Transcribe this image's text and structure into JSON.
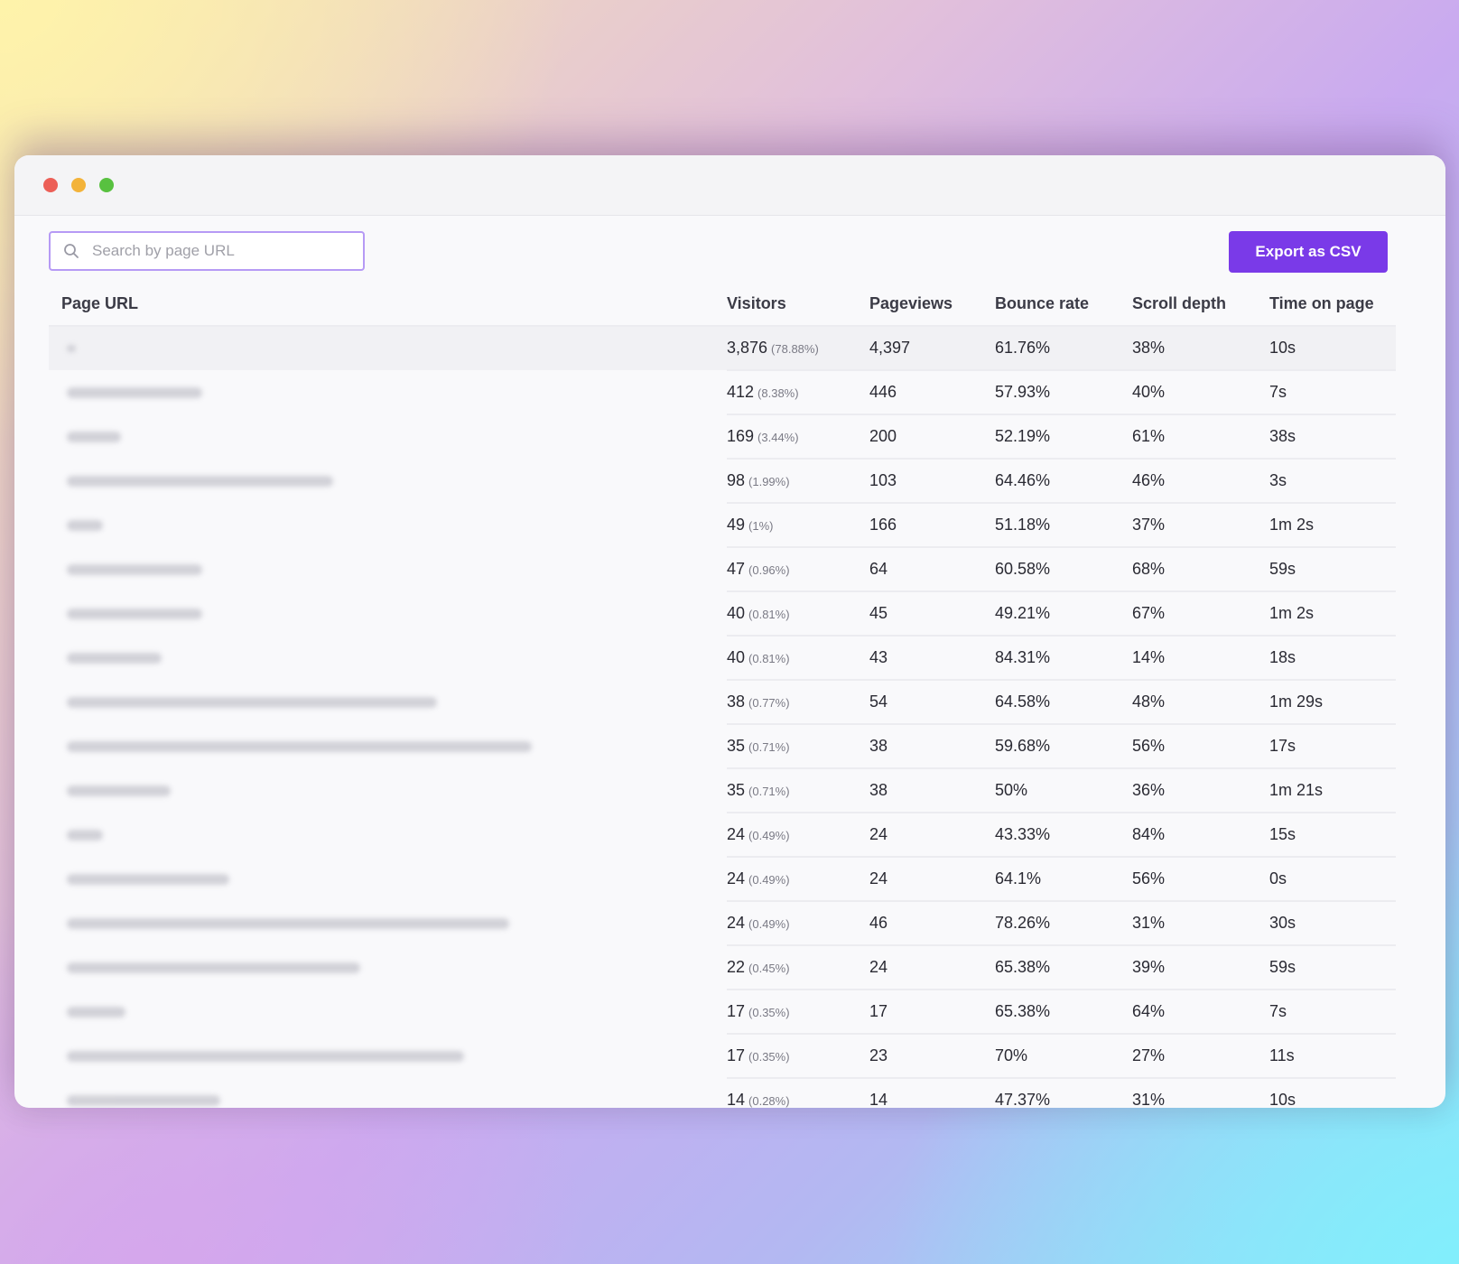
{
  "window": {
    "controls": [
      {
        "name": "close",
        "color": "#ec5f57"
      },
      {
        "name": "minimize",
        "color": "#f3b33a"
      },
      {
        "name": "maximize",
        "color": "#58c140"
      }
    ]
  },
  "toolbar": {
    "search_placeholder": "Search by page URL",
    "search_icon": "search-icon",
    "export_label": "Export as CSV",
    "accent_color": "#7a3ae8"
  },
  "table": {
    "headers": [
      "Page URL",
      "Visitors",
      "Pageviews",
      "Bounce rate",
      "Scroll depth",
      "Time on page"
    ],
    "rows": [
      {
        "url_blurred": true,
        "visitors": "3,876",
        "visitors_pct": "(78.88%)",
        "pageviews": "4,397",
        "bounce": "61.76%",
        "scroll": "38%",
        "time": "10s"
      },
      {
        "url_blurred": true,
        "visitors": "412",
        "visitors_pct": "(8.38%)",
        "pageviews": "446",
        "bounce": "57.93%",
        "scroll": "40%",
        "time": "7s"
      },
      {
        "url_blurred": true,
        "visitors": "169",
        "visitors_pct": "(3.44%)",
        "pageviews": "200",
        "bounce": "52.19%",
        "scroll": "61%",
        "time": "38s"
      },
      {
        "url_blurred": true,
        "visitors": "98",
        "visitors_pct": "(1.99%)",
        "pageviews": "103",
        "bounce": "64.46%",
        "scroll": "46%",
        "time": "3s"
      },
      {
        "url_blurred": true,
        "visitors": "49",
        "visitors_pct": "(1%)",
        "pageviews": "166",
        "bounce": "51.18%",
        "scroll": "37%",
        "time": "1m 2s"
      },
      {
        "url_blurred": true,
        "visitors": "47",
        "visitors_pct": "(0.96%)",
        "pageviews": "64",
        "bounce": "60.58%",
        "scroll": "68%",
        "time": "59s"
      },
      {
        "url_blurred": true,
        "visitors": "40",
        "visitors_pct": "(0.81%)",
        "pageviews": "45",
        "bounce": "49.21%",
        "scroll": "67%",
        "time": "1m 2s"
      },
      {
        "url_blurred": true,
        "visitors": "40",
        "visitors_pct": "(0.81%)",
        "pageviews": "43",
        "bounce": "84.31%",
        "scroll": "14%",
        "time": "18s"
      },
      {
        "url_blurred": true,
        "visitors": "38",
        "visitors_pct": "(0.77%)",
        "pageviews": "54",
        "bounce": "64.58%",
        "scroll": "48%",
        "time": "1m 29s"
      },
      {
        "url_blurred": true,
        "visitors": "35",
        "visitors_pct": "(0.71%)",
        "pageviews": "38",
        "bounce": "59.68%",
        "scroll": "56%",
        "time": "17s"
      },
      {
        "url_blurred": true,
        "visitors": "35",
        "visitors_pct": "(0.71%)",
        "pageviews": "38",
        "bounce": "50%",
        "scroll": "36%",
        "time": "1m 21s"
      },
      {
        "url_blurred": true,
        "visitors": "24",
        "visitors_pct": "(0.49%)",
        "pageviews": "24",
        "bounce": "43.33%",
        "scroll": "84%",
        "time": "15s"
      },
      {
        "url_blurred": true,
        "visitors": "24",
        "visitors_pct": "(0.49%)",
        "pageviews": "24",
        "bounce": "64.1%",
        "scroll": "56%",
        "time": "0s"
      },
      {
        "url_blurred": true,
        "visitors": "24",
        "visitors_pct": "(0.49%)",
        "pageviews": "46",
        "bounce": "78.26%",
        "scroll": "31%",
        "time": "30s"
      },
      {
        "url_blurred": true,
        "visitors": "22",
        "visitors_pct": "(0.45%)",
        "pageviews": "24",
        "bounce": "65.38%",
        "scroll": "39%",
        "time": "59s"
      },
      {
        "url_blurred": true,
        "visitors": "17",
        "visitors_pct": "(0.35%)",
        "pageviews": "17",
        "bounce": "65.38%",
        "scroll": "64%",
        "time": "7s"
      },
      {
        "url_blurred": true,
        "visitors": "17",
        "visitors_pct": "(0.35%)",
        "pageviews": "23",
        "bounce": "70%",
        "scroll": "27%",
        "time": "11s"
      },
      {
        "url_blurred": true,
        "visitors": "14",
        "visitors_pct": "(0.28%)",
        "pageviews": "14",
        "bounce": "47.37%",
        "scroll": "31%",
        "time": "10s"
      }
    ]
  },
  "chat": {
    "icon": "chat-bubble-icon",
    "color": "#8b4de6"
  }
}
